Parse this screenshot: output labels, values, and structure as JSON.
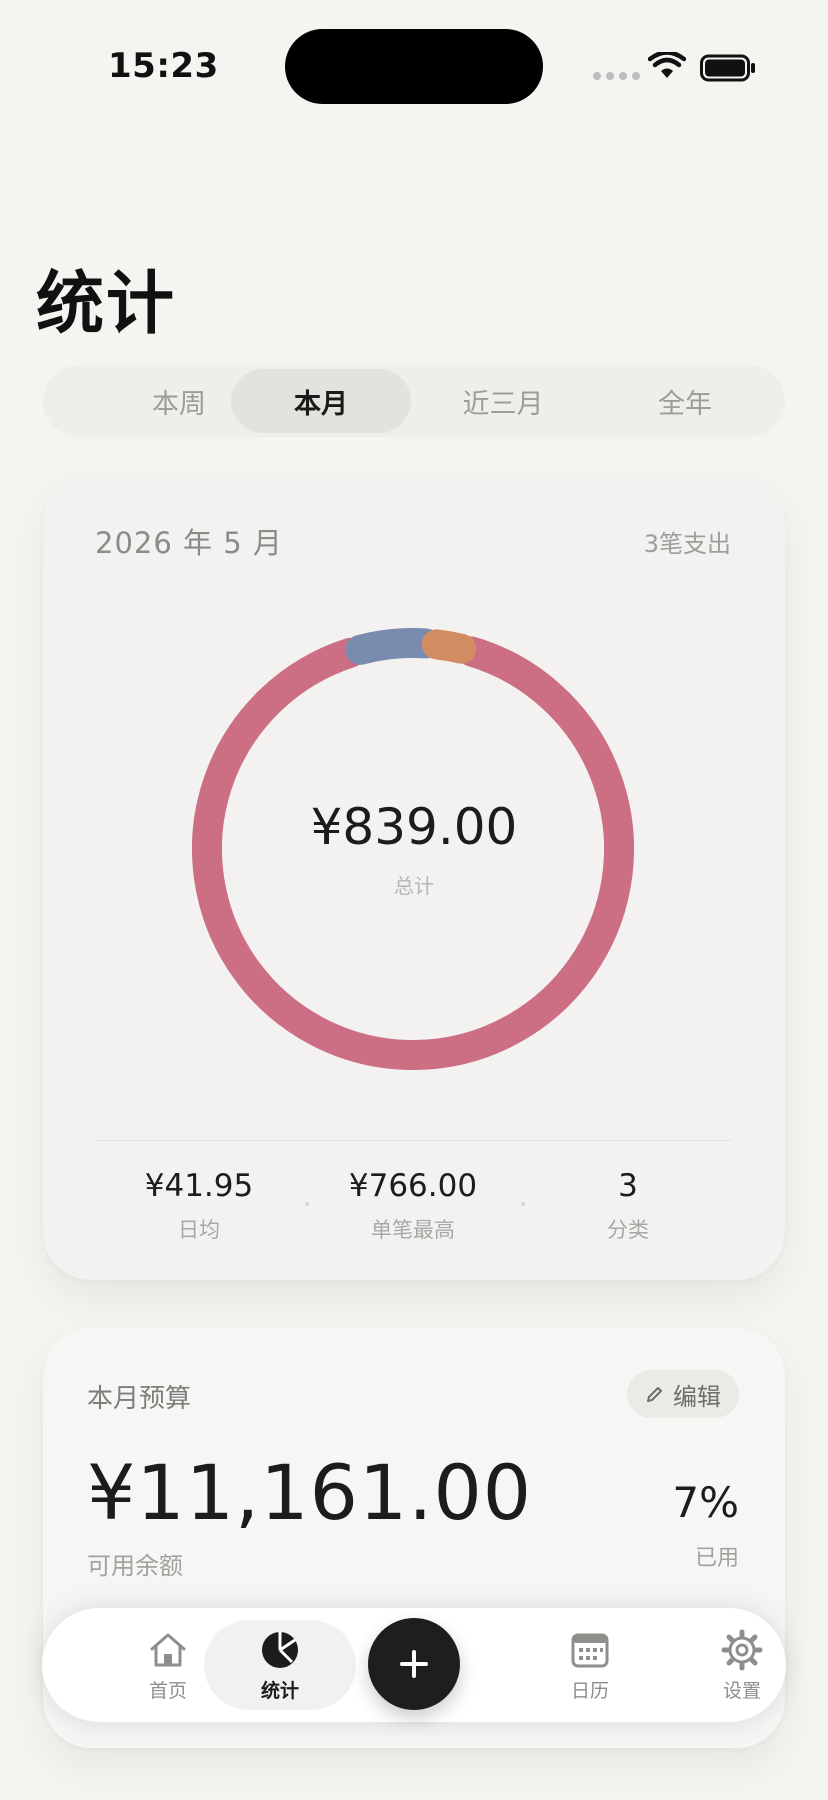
{
  "status_bar": {
    "time": "15:23"
  },
  "header": {
    "title": "统计"
  },
  "period_tabs": [
    {
      "label": "本周",
      "active": false
    },
    {
      "label": "本月",
      "active": true
    },
    {
      "label": "近三月",
      "active": false
    },
    {
      "label": "全年",
      "active": false
    }
  ],
  "summary": {
    "period": "2026 年 5 月",
    "count": "3笔支出",
    "total": "¥839.00",
    "total_label": "总计",
    "stats": [
      {
        "value": "¥41.95",
        "label": "日均"
      },
      {
        "value": "¥766.00",
        "label": "单笔最高"
      },
      {
        "value": "3",
        "label": "分类"
      }
    ]
  },
  "chart_data": {
    "type": "pie",
    "style": "donut",
    "total": 839.0,
    "segments": [
      {
        "value": 766.0,
        "color": "#cc6f84"
      },
      {
        "value": 50.0,
        "color": "#7a8bb0"
      },
      {
        "value": 23.0,
        "color": "#d28c62"
      }
    ]
  },
  "budget": {
    "title": "本月预算",
    "edit_label": "编辑",
    "amount": "¥11,161.00",
    "amount_label": "可用余额",
    "used_pct": "7%",
    "used_label": "已用"
  },
  "tabbar": {
    "items": [
      {
        "label": "首页",
        "icon": "house-icon"
      },
      {
        "label": "统计",
        "icon": "pie-chart-icon",
        "active": true
      },
      {
        "label": "日历",
        "icon": "calendar-icon"
      },
      {
        "label": "设置",
        "icon": "gear-icon"
      }
    ],
    "add_icon": "plus-icon"
  },
  "colors": {
    "accent": "#cc6f84",
    "background": "#f5f4f1"
  }
}
